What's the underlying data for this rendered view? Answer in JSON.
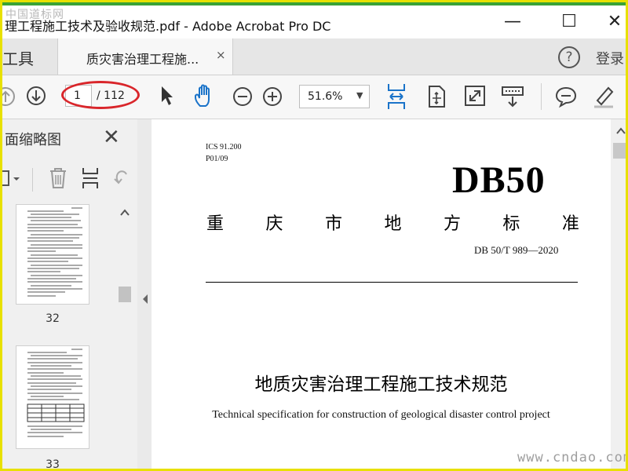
{
  "window": {
    "title": "理工程施工技术及验收规范.pdf - Adobe Acrobat Pro DC",
    "minimize_glyph": "—",
    "maximize_glyph": "☐",
    "close_glyph": "✕"
  },
  "watermark": {
    "logo_text": "中国道标网",
    "url": "www.cndao.com"
  },
  "tabs": {
    "tools_label": "工具",
    "doc_tab_label": "质灾害治理工程施...",
    "doc_tab_close": "×",
    "help_glyph": "?",
    "login_label": "登录"
  },
  "toolbar": {
    "current_page": "1",
    "page_total": "/ 112",
    "zoom_value": "51.6%",
    "zoom_caret": "▼",
    "accent_color": "#1a73c9",
    "annotation_color": "#d9262b"
  },
  "sidebar": {
    "title": "面缩略图",
    "close_glyph": "✕",
    "thumbnails": [
      {
        "page": "32"
      },
      {
        "page": "33"
      }
    ]
  },
  "document": {
    "ics": "ICS 91.200",
    "p_code": "P01/09",
    "db_code": "DB50",
    "region_chars": [
      "重",
      "庆",
      "市",
      "地",
      "方",
      "标",
      "准"
    ],
    "standard_number": "DB 50/T  989—2020",
    "title_cn": "地质灾害治理工程施工技术规范",
    "title_en": "Technical specification for construction of geological disaster control project"
  }
}
